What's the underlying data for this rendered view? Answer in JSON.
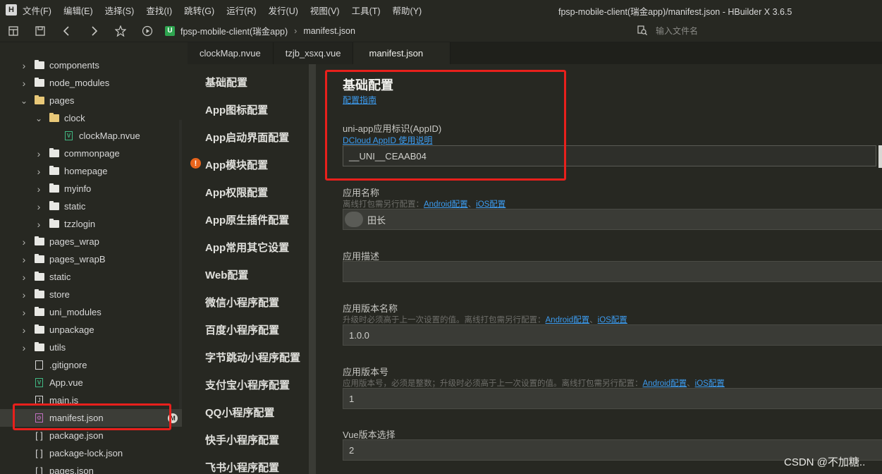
{
  "menubar": {
    "logo_text": "H",
    "items": [
      "文件(F)",
      "编辑(E)",
      "选择(S)",
      "查找(I)",
      "跳转(G)",
      "运行(R)",
      "发行(U)",
      "视图(V)",
      "工具(T)",
      "帮助(Y)"
    ],
    "window_title": "fpsp-mobile-client(瑞金app)/manifest.json - HBuilder X 3.6.5"
  },
  "toolbar": {
    "icons": [
      "window-icon",
      "save-icon",
      "back-icon",
      "forward-icon",
      "star-icon",
      "play-icon"
    ],
    "breadcrumb": {
      "badge": "U",
      "project": "fpsp-mobile-client(瑞金app)",
      "separator": "›",
      "file": "manifest.json"
    },
    "file_search_placeholder": "输入文件名"
  },
  "sidebar": {
    "items": [
      {
        "label": "components",
        "type": "folder",
        "level": 1,
        "state": "collapsed"
      },
      {
        "label": "node_modules",
        "type": "folder",
        "level": 1,
        "state": "collapsed"
      },
      {
        "label": "pages",
        "type": "folder",
        "level": 1,
        "state": "expanded"
      },
      {
        "label": "clock",
        "type": "folder",
        "level": 2,
        "state": "expanded"
      },
      {
        "label": "clockMap.nvue",
        "type": "vue",
        "level": 3
      },
      {
        "label": "commonpage",
        "type": "folder",
        "level": 2,
        "state": "collapsed"
      },
      {
        "label": "homepage",
        "type": "folder",
        "level": 2,
        "state": "collapsed"
      },
      {
        "label": "myinfo",
        "type": "folder",
        "level": 2,
        "state": "collapsed"
      },
      {
        "label": "static",
        "type": "folder",
        "level": 2,
        "state": "collapsed"
      },
      {
        "label": "tzzlogin",
        "type": "folder",
        "level": 2,
        "state": "collapsed"
      },
      {
        "label": "pages_wrap",
        "type": "folder",
        "level": 1,
        "state": "collapsed"
      },
      {
        "label": "pages_wrapB",
        "type": "folder",
        "level": 1,
        "state": "collapsed"
      },
      {
        "label": "static",
        "type": "folder",
        "level": 1,
        "state": "collapsed"
      },
      {
        "label": "store",
        "type": "folder",
        "level": 1,
        "state": "collapsed"
      },
      {
        "label": "uni_modules",
        "type": "folder",
        "level": 1,
        "state": "collapsed"
      },
      {
        "label": "unpackage",
        "type": "folder",
        "level": 1,
        "state": "collapsed"
      },
      {
        "label": "utils",
        "type": "folder",
        "level": 1,
        "state": "collapsed"
      },
      {
        "label": ".gitignore",
        "type": "file",
        "level": 1
      },
      {
        "label": "App.vue",
        "type": "vue",
        "level": 1
      },
      {
        "label": "main.js",
        "type": "js",
        "level": 1
      },
      {
        "label": "manifest.json",
        "type": "manifest",
        "level": 1,
        "selected": true,
        "badge": "M"
      },
      {
        "label": "package.json",
        "type": "json",
        "level": 1
      },
      {
        "label": "package-lock.json",
        "type": "json",
        "level": 1
      },
      {
        "label": "pages.json",
        "type": "json",
        "level": 1
      }
    ]
  },
  "tabs": [
    {
      "label": "clockMap.nvue",
      "active": false
    },
    {
      "label": "tzjb_xsxq.vue",
      "active": false
    },
    {
      "label": "manifest.json",
      "active": true
    }
  ],
  "sections": [
    {
      "label": "基础配置"
    },
    {
      "label": "App图标配置"
    },
    {
      "label": "App启动界面配置"
    },
    {
      "label": "App模块配置",
      "warning": "!"
    },
    {
      "label": "App权限配置"
    },
    {
      "label": "App原生插件配置"
    },
    {
      "label": "App常用其它设置"
    },
    {
      "label": "Web配置"
    },
    {
      "label": "微信小程序配置"
    },
    {
      "label": "百度小程序配置"
    },
    {
      "label": "字节跳动小程序配置"
    },
    {
      "label": "支付宝小程序配置"
    },
    {
      "label": "QQ小程序配置"
    },
    {
      "label": "快手小程序配置"
    },
    {
      "label": "飞书小程序配置"
    }
  ],
  "form": {
    "title": "基础配置",
    "guide_link": "配置指南",
    "appid": {
      "label": "uni-app应用标识(AppID)",
      "link": "DCloud AppID 使用说明",
      "value": "__UNI__CEAAB04"
    },
    "app_name": {
      "label": "应用名称",
      "hint": "离线打包需另行配置：",
      "link_android": "Android配置",
      "link_sep": "、",
      "link_ios": "iOS配置",
      "value": "田长"
    },
    "app_desc": {
      "label": "应用描述",
      "value": ""
    },
    "version_name": {
      "label": "应用版本名称",
      "hint": "升级时必须高于上一次设置的值。离线打包需另行配置：",
      "link_android": "Android配置",
      "link_sep": "、",
      "link_ios": "iOS配置",
      "value": "1.0.0"
    },
    "version_code": {
      "label": "应用版本号",
      "hint": "应用版本号，必须是整数；升级时必须高于上一次设置的值。离线打包需另行配置：",
      "link_android": "Android配置",
      "link_sep": "、",
      "link_ios": "iOS配置",
      "value": "1"
    },
    "vue_version": {
      "label": "Vue版本选择",
      "value": "2"
    }
  },
  "watermark": "CSDN @不加糖..",
  "colors": {
    "background": "#272822",
    "highlight_box": "#e8201c",
    "link": "#3d9cf0",
    "warning": "#e8641c"
  }
}
